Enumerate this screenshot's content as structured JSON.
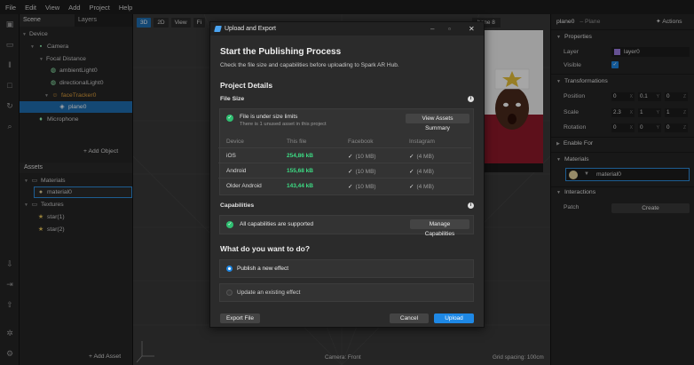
{
  "menu": [
    "File",
    "Edit",
    "View",
    "Add",
    "Project",
    "Help"
  ],
  "scene_panel": {
    "tabs": [
      "Scene",
      "Layers"
    ],
    "tree": [
      {
        "label": "Device",
        "indent": 0
      },
      {
        "label": "Camera",
        "indent": 1
      },
      {
        "label": "Focal Distance",
        "indent": 2
      },
      {
        "label": "ambientLight0",
        "indent": 3
      },
      {
        "label": "directionalLight0",
        "indent": 3
      },
      {
        "label": "faceTracker0",
        "indent": 3
      },
      {
        "label": "plane0",
        "indent": 4
      },
      {
        "label": "Microphone",
        "indent": 1
      }
    ],
    "add_object": "Add Object",
    "assets_title": "Assets",
    "assets": [
      {
        "label": "Materials"
      },
      {
        "label": "material0"
      },
      {
        "label": "Textures"
      },
      {
        "label": "star(1)"
      },
      {
        "label": "star(2)"
      }
    ],
    "add_asset": "Add Asset"
  },
  "viewport": {
    "btn_3d": "3D",
    "btn_2d": "2D",
    "view_btn": "View",
    "fi_btn": "Fi",
    "device": "hone 8",
    "camera_label": "Camera: Front",
    "grid_label": "Grid spacing: 100cm"
  },
  "right_panel": {
    "object_name": "plane0",
    "object_type": "– Plane",
    "actions": "Actions",
    "properties": "Properties",
    "layer_label": "Layer",
    "layer_value": "layer0",
    "visible_label": "Visible",
    "transformations": "Transformations",
    "position_label": "Position",
    "position": [
      "0",
      "0.1",
      "0"
    ],
    "scale_label": "Scale",
    "scale": [
      "2.3",
      "1",
      "1"
    ],
    "rotation_label": "Rotation",
    "rotation": [
      "0",
      "0",
      "0"
    ],
    "enable_for": "Enable For",
    "materials": "Materials",
    "material_value": "material0",
    "interactions": "Interactions",
    "patch_label": "Patch",
    "create_btn": "Create",
    "axes": [
      "X",
      "Y",
      "Z"
    ]
  },
  "dialog": {
    "title": "Upload and Export",
    "heading": "Start the Publishing Process",
    "subtitle": "Check the file size and capabilities before uploading to Spark AR Hub.",
    "project_details": "Project Details",
    "file_size_label": "File Size",
    "size_status": "File is under size limits",
    "size_note": "There is 1 unused asset in this project",
    "view_assets_btn": "View Assets Summary",
    "table_headers": [
      "Device",
      "This file",
      "Facebook",
      "Instagram"
    ],
    "rows": [
      {
        "device": "iOS",
        "size": "254,86 kB",
        "facebook": "(10 MB)",
        "instagram": "(4 MB)"
      },
      {
        "device": "Android",
        "size": "155,68 kB",
        "facebook": "(10 MB)",
        "instagram": "(4 MB)"
      },
      {
        "device": "Older Android",
        "size": "143,44 kB",
        "facebook": "(10 MB)",
        "instagram": "(4 MB)"
      }
    ],
    "capabilities_label": "Capabilities",
    "capabilities_status": "All capabilities are supported",
    "manage_btn": "Manage Capabilities",
    "question": "What do you want to do?",
    "option_publish": "Publish a new effect",
    "option_update": "Update an existing effect",
    "export_btn": "Export File",
    "cancel_btn": "Cancel",
    "upload_btn": "Upload"
  },
  "colors": {
    "accent": "#1e88e5",
    "ok": "#2fbf71",
    "size_green": "#3ddc84",
    "highlight": "#e3a23c"
  }
}
